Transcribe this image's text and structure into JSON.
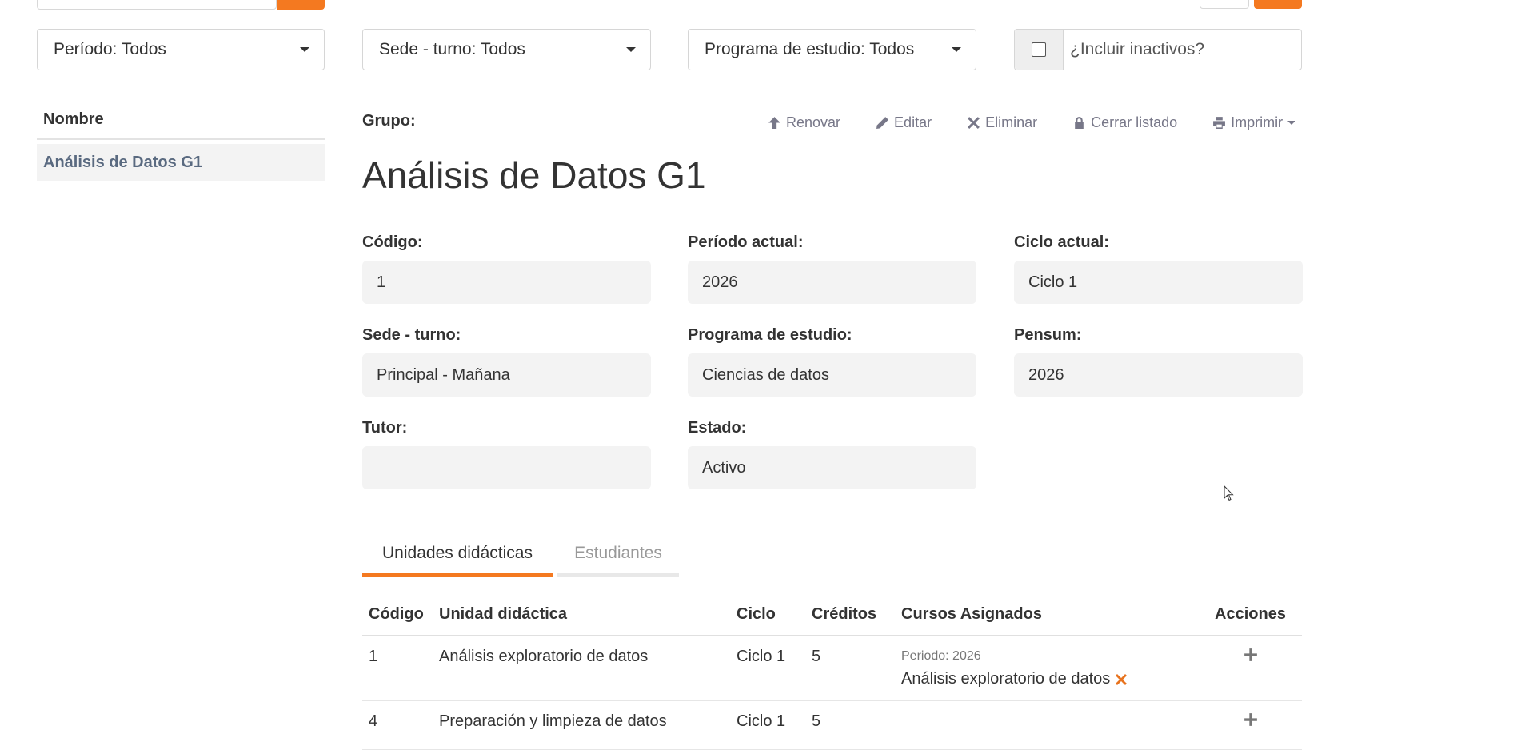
{
  "filters": {
    "periodo": "Período: Todos",
    "sede_turno": "Sede - turno: Todos",
    "programa": "Programa de estudio: Todos",
    "incluir_inactivos": "¿Incluir inactivos?"
  },
  "list": {
    "header": "Nombre",
    "items": [
      "Análisis de Datos G1"
    ]
  },
  "detail": {
    "grupo_label": "Grupo:",
    "title": "Análisis de Datos G1",
    "toolbar": {
      "renovar": "Renovar",
      "editar": "Editar",
      "eliminar": "Eliminar",
      "cerrar": "Cerrar listado",
      "imprimir": "Imprimir"
    },
    "fields": {
      "codigo": {
        "label": "Código:",
        "value": "1"
      },
      "periodo_actual": {
        "label": "Período actual:",
        "value": "2026"
      },
      "ciclo_actual": {
        "label": "Ciclo actual:",
        "value": "Ciclo 1"
      },
      "sede_turno": {
        "label": "Sede - turno:",
        "value": "Principal - Mañana"
      },
      "programa": {
        "label": "Programa de estudio:",
        "value": "Ciencias de datos"
      },
      "pensum": {
        "label": "Pensum:",
        "value": "2026"
      },
      "tutor": {
        "label": "Tutor:",
        "value": ""
      },
      "estado": {
        "label": "Estado:",
        "value": "Activo"
      }
    }
  },
  "tabs": {
    "unidades": "Unidades didácticas",
    "estudiantes": "Estudiantes"
  },
  "table": {
    "headers": {
      "codigo": "Código",
      "unidad": "Unidad didáctica",
      "ciclo": "Ciclo",
      "creditos": "Créditos",
      "cursos": "Cursos Asignados",
      "acciones": "Acciones"
    },
    "rows": [
      {
        "codigo": "1",
        "unidad": "Análisis exploratorio de datos",
        "ciclo": "Ciclo 1",
        "creditos": "5",
        "periodo_label": "Periodo: 2026",
        "curso": "Análisis exploratorio de datos"
      },
      {
        "codigo": "4",
        "unidad": "Preparación y limpieza de datos",
        "ciclo": "Ciclo 1",
        "creditos": "5",
        "periodo_label": "",
        "curso": ""
      }
    ]
  },
  "colors": {
    "accent": "#f47920",
    "muted_text": "#778",
    "field_bg": "#f3f3f3",
    "delete_x": "#e8731e"
  }
}
